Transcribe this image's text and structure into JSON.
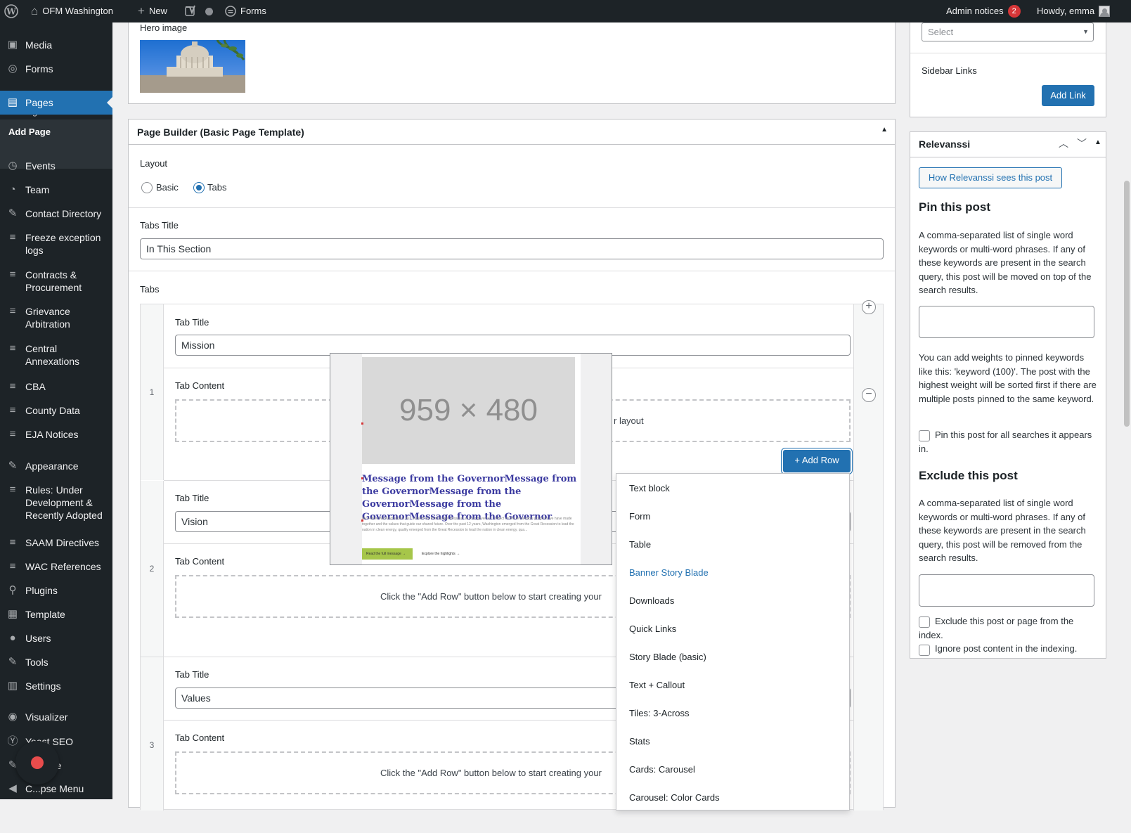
{
  "adminbar": {
    "site_name": "OFM Washington",
    "new_label": "New",
    "forms_label": "Forms",
    "admin_notices_label": "Admin notices",
    "admin_notices_count": "2",
    "howdy": "Howdy, emma"
  },
  "menu": {
    "items": [
      {
        "label": "Media",
        "icon": "media-icon"
      },
      {
        "label": "Forms",
        "icon": "forms-icon"
      },
      {
        "label": "Pages",
        "icon": "pages-icon",
        "current": true
      },
      {
        "label": "Events",
        "icon": "events-icon"
      },
      {
        "label": "Team",
        "icon": "team-icon"
      },
      {
        "label": "Contact Directory",
        "icon": "contact-icon"
      },
      {
        "label": "Freeze exception logs",
        "icon": "database-icon"
      },
      {
        "label": "Contracts & Procurement",
        "icon": "database-icon"
      },
      {
        "label": "Grievance Arbitration",
        "icon": "database-icon"
      },
      {
        "label": "Central Annexations",
        "icon": "database-icon"
      },
      {
        "label": "CBA",
        "icon": "database-icon"
      },
      {
        "label": "County Data",
        "icon": "database-icon"
      },
      {
        "label": "EJA Notices",
        "icon": "database-icon"
      },
      {
        "label": "Appearance",
        "icon": "appearance-icon"
      },
      {
        "label": "Rules: Under Development & Recently Adopted",
        "icon": "database-icon"
      },
      {
        "label": "SAAM Directives",
        "icon": "database-icon"
      },
      {
        "label": "WAC References",
        "icon": "database-icon"
      },
      {
        "label": "Plugins",
        "icon": "plugins-icon"
      },
      {
        "label": "Template",
        "icon": "template-icon"
      },
      {
        "label": "Users",
        "icon": "users-icon"
      },
      {
        "label": "Tools",
        "icon": "tools-icon"
      },
      {
        "label": "Settings",
        "icon": "settings-icon"
      },
      {
        "label": "Visualizer",
        "icon": "visualizer-icon"
      },
      {
        "label": "Yoast SEO",
        "icon": "yoast-icon"
      },
      {
        "label": "...rname",
        "icon": "edit-icon"
      },
      {
        "label": "C...pse Menu",
        "icon": "collapse-icon"
      }
    ],
    "submenu": {
      "all_pages": "All Pages",
      "add_page": "Add Page"
    }
  },
  "hero": {
    "label": "Hero image"
  },
  "page_builder": {
    "title": "Page Builder (Basic Page Template)",
    "layout_label": "Layout",
    "layout_options": [
      "Basic",
      "Tabs"
    ],
    "layout_selected": "Tabs",
    "tabs_title_label": "Tabs Title",
    "tabs_title_value": "In This Section",
    "tabs_label": "Tabs",
    "tab_title_label": "Tab Title",
    "tab_content_label": "Tab Content",
    "empty_prompt": "Click the \"Add Row\" button below to start creating your layout",
    "empty_prompt_short": "Click the \"Add Row\" button below to start creating your",
    "empty_prompt_tail": "r layout",
    "add_row": "Add Row",
    "tabs": [
      {
        "index": "1",
        "title": "Mission"
      },
      {
        "index": "2",
        "title": "Vision"
      },
      {
        "index": "3",
        "title": "Values"
      }
    ]
  },
  "row_menu": {
    "items": [
      "Text block",
      "Form",
      "Table",
      "Banner Story Blade",
      "Downloads",
      "Quick Links",
      "Story Blade (basic)",
      "Text + Callout",
      "Tiles: 3-Across",
      "Stats",
      "Cards: Carousel",
      "Carousel: Color Cards"
    ],
    "active": "Banner Story Blade"
  },
  "preview": {
    "placeholder": "959 × 480",
    "headline": "Message from the GovernorMessage from the GovernorMessage from the GovernorMessage from the GovernorMessage from the Governor",
    "body": "My Fellow Washingtonians, As I present my final budget proposal as your governor, I reflect on the remarkable progress we have made together and the values that guide our shared future. Over the past 12 years, Washington emerged from the Great Recession to lead the nation in clean energy, quality emerged from the Great Recession to lead the nation in clean energy, qua...",
    "cta": "Read the full message →",
    "cta2": "Explore the highlights →"
  },
  "right": {
    "select_placeholder": "Select",
    "sidebar_links_label": "Sidebar Links",
    "add_link": "Add Link",
    "relevanssi_title": "Relevanssi",
    "how_button": "How Relevanssi sees this post",
    "pin_title": "Pin this post",
    "pin_desc": "A comma-separated list of single word keywords or multi-word phrases. If any of these keywords are present in the search query, this post will be moved on top of the search results.",
    "weights_desc": "You can add weights to pinned keywords like this: 'keyword (100)'. The post with the highest weight will be sorted first if there are multiple posts pinned to the same keyword.",
    "pin_all": "Pin this post for all searches it appears in.",
    "exclude_title": "Exclude this post",
    "exclude_desc": "A comma-separated list of single word keywords or multi-word phrases. If any of these keywords are present in the search query, this post will be removed from the search results.",
    "exclude_index": "Exclude this post or page from the index.",
    "ignore_content": "Ignore post content in the indexing."
  },
  "colors": {
    "accent": "#2271b1",
    "adminbar": "#1d2327",
    "notice": "#d63638"
  }
}
